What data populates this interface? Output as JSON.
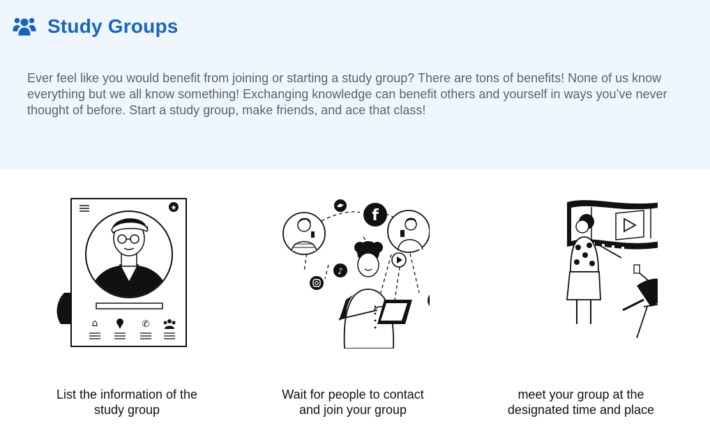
{
  "header": {
    "icon": "users-icon",
    "title": "Study Groups",
    "description": "Ever feel like you would benefit from joining or starting a study group? There are tons of benefits! None of us know everything but we all know something! Exchanging knowledge can benefit others and yourself in ways you’ve never thought of before. Start a study group, make friends, and ace that class!"
  },
  "colors": {
    "brand": "#1565c0",
    "hero_bg": "#eff6ff",
    "body_text": "#5b6270"
  },
  "steps": [
    {
      "illustration": "profile-card-illustration",
      "caption_line1": "List the information of the",
      "caption_line2": "study group"
    },
    {
      "illustration": "social-network-illustration",
      "caption_line1": "Wait for people to contact",
      "caption_line2": "and join your group"
    },
    {
      "illustration": "meeting-illustration",
      "caption_line1": "meet your group at the",
      "caption_line2": "designated time and place"
    }
  ]
}
